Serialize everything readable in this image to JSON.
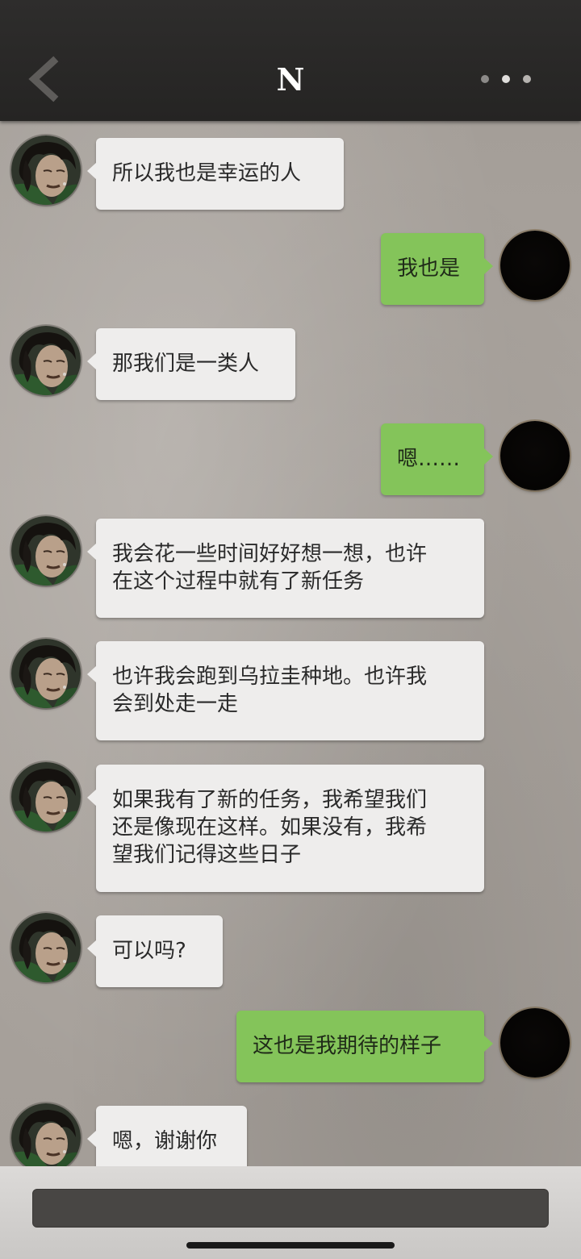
{
  "header": {
    "title": "N",
    "back_icon": "chevron-left-icon",
    "more_icon": "more-dots-icon"
  },
  "messages": [
    {
      "side": "in",
      "text": "所以我也是幸运的人"
    },
    {
      "side": "out",
      "text": "我也是"
    },
    {
      "side": "in",
      "text": "那我们是一类人"
    },
    {
      "side": "out",
      "text": "嗯……"
    },
    {
      "side": "in",
      "text": "我会花一些时间好好想一想，也许\n在这个过程中就有了新任务"
    },
    {
      "side": "in",
      "text": "也许我会跑到乌拉圭种地。也许我\n会到处走一走"
    },
    {
      "side": "in",
      "text": "如果我有了新的任务，我希望我们\n还是像现在这样。如果没有，我希\n望我们记得这些日子"
    },
    {
      "side": "in",
      "text": "可以吗?"
    },
    {
      "side": "out",
      "text": "这也是我期待的样子"
    },
    {
      "side": "in",
      "text": "嗯，谢谢你"
    }
  ],
  "input": {
    "placeholder": ""
  },
  "colors": {
    "incoming_bubble": "#eeedec",
    "outgoing_bubble": "#84c45a",
    "header": "#2a2928",
    "background": "#a7a19b"
  }
}
